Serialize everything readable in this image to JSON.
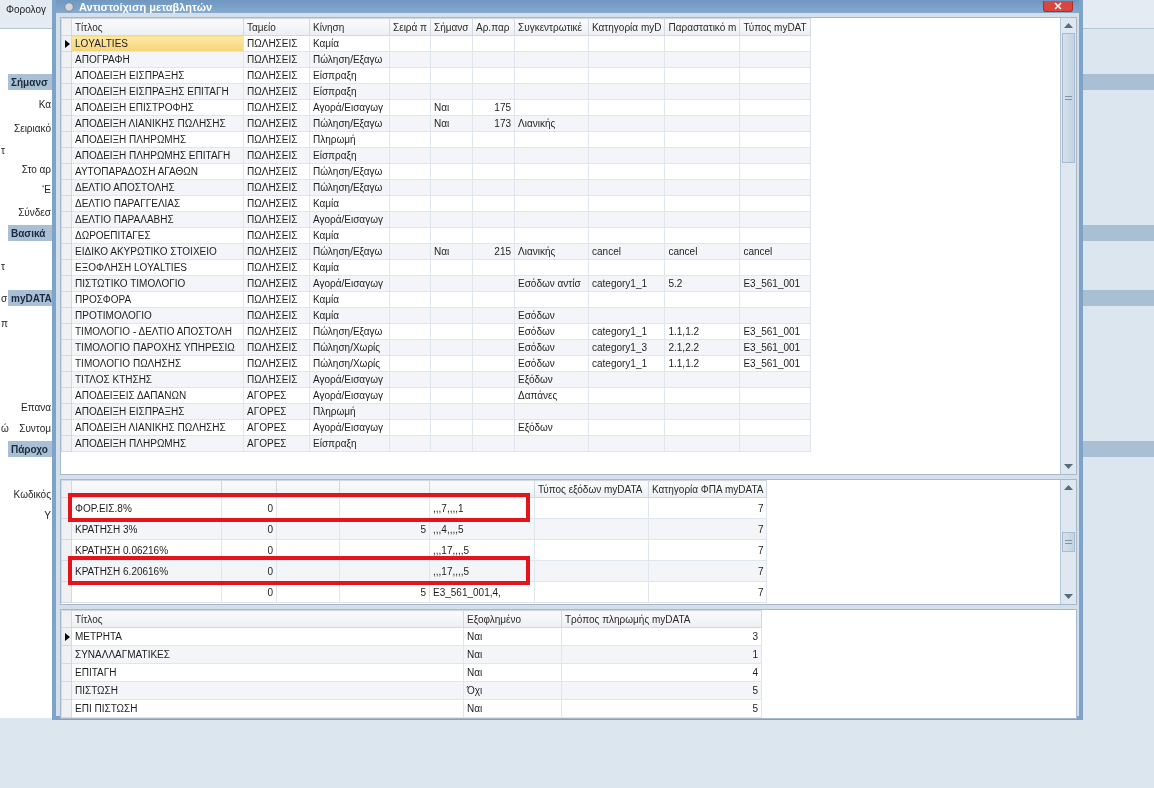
{
  "background": {
    "title": "Φορολογ",
    "side": [
      {
        "kind": "header",
        "text": "Σήμανσ"
      },
      {
        "kind": "label",
        "text": "Κα"
      },
      {
        "kind": "label",
        "text": "Σειριακό"
      },
      {
        "kind": "stub",
        "text": "τ"
      },
      {
        "kind": "label",
        "text": "Στο αρ"
      },
      {
        "kind": "label",
        "text": "‘Ε"
      },
      {
        "kind": "label",
        "text": "Σύνδεσ"
      },
      {
        "kind": "header",
        "text": "Βασικά"
      },
      {
        "kind": "stub",
        "text": "τ"
      },
      {
        "kind": "header",
        "text": "myDATA",
        "stub": "σ"
      },
      {
        "kind": "stub",
        "text": "π"
      },
      {
        "kind": "label",
        "text": "Επανα"
      },
      {
        "kind": "label",
        "text": "Συντομ",
        "stub": "ώ"
      },
      {
        "kind": "header",
        "text": "Πάροχο"
      },
      {
        "kind": "label",
        "text": "Κωδικός"
      },
      {
        "kind": "label",
        "text": "Υ"
      }
    ]
  },
  "dialog": {
    "title": "Αντιστοίχιση μεταβλητών",
    "top": {
      "columns": [
        "Τίτλος",
        "Ταμείο",
        "Κίνηση",
        "Σειρά π",
        "Σήμανσ",
        "Αρ.παρ",
        "Συγκεντρωτικέ",
        "Κατηγορία myD",
        "Παραστατικό m",
        "Τύπος myDAT"
      ],
      "rows": [
        {
          "selected": true,
          "cells": [
            "LOYALTIES",
            "ΠΩΛΗΣΕΙΣ",
            "Καμία",
            null,
            null,
            null,
            null,
            null,
            null,
            null
          ]
        },
        {
          "selected": false,
          "cells": [
            "ΑΠΟΓΡΑΦΗ",
            "ΠΩΛΗΣΕΙΣ",
            "Πώληση/Εξαγω",
            null,
            null,
            null,
            null,
            null,
            null,
            null
          ]
        },
        {
          "selected": false,
          "cells": [
            "ΑΠΟΔΕΙΞΗ ΕΙΣΠΡΑΞΗΣ",
            "ΠΩΛΗΣΕΙΣ",
            "Είσπραξη",
            null,
            null,
            null,
            null,
            null,
            null,
            null
          ]
        },
        {
          "selected": false,
          "cells": [
            "ΑΠΟΔΕΙΞΗ ΕΙΣΠΡΑΞΗΣ ΕΠΙΤΑΓΗ",
            "ΠΩΛΗΣΕΙΣ",
            "Είσπραξη",
            null,
            null,
            null,
            null,
            null,
            null,
            null
          ]
        },
        {
          "selected": false,
          "cells": [
            "ΑΠΟΔΕΙΞΗ ΕΠΙΣΤΡΟΦΗΣ",
            "ΠΩΛΗΣΕΙΣ",
            "Αγορά/Εισαγωγ",
            null,
            "Ναι",
            "175",
            null,
            null,
            null,
            null
          ]
        },
        {
          "selected": false,
          "cells": [
            "ΑΠΟΔΕΙΞΗ ΛΙΑΝΙΚΗΣ ΠΩΛΗΣΗΣ",
            "ΠΩΛΗΣΕΙΣ",
            "Πώληση/Εξαγω",
            null,
            "Ναι",
            "173",
            "Λιανικής",
            null,
            null,
            null
          ]
        },
        {
          "selected": false,
          "cells": [
            "ΑΠΟΔΕΙΞΗ ΠΛΗΡΩΜΗΣ",
            "ΠΩΛΗΣΕΙΣ",
            "Πληρωμή",
            null,
            null,
            null,
            null,
            null,
            null,
            null
          ]
        },
        {
          "selected": false,
          "cells": [
            "ΑΠΟΔΕΙΞΗ ΠΛΗΡΩΜΗΣ ΕΠΙΤΑΓΗ",
            "ΠΩΛΗΣΕΙΣ",
            "Είσπραξη",
            null,
            null,
            null,
            null,
            null,
            null,
            null
          ]
        },
        {
          "selected": false,
          "cells": [
            "ΑΥΤΟΠΑΡΑΔΟΣΗ ΑΓΑΘΩΝ",
            "ΠΩΛΗΣΕΙΣ",
            "Πώληση/Εξαγω",
            null,
            null,
            null,
            null,
            null,
            null,
            null
          ]
        },
        {
          "selected": false,
          "cells": [
            "ΔΕΛΤΙΟ ΑΠΟΣΤΟΛΗΣ",
            "ΠΩΛΗΣΕΙΣ",
            "Πώληση/Εξαγω",
            null,
            null,
            null,
            null,
            null,
            null,
            null
          ]
        },
        {
          "selected": false,
          "cells": [
            "ΔΕΛΤΙΟ ΠΑΡΑΓΓΕΛΙΑΣ",
            "ΠΩΛΗΣΕΙΣ",
            "Καμία",
            null,
            null,
            null,
            null,
            null,
            null,
            null
          ]
        },
        {
          "selected": false,
          "cells": [
            "ΔΕΛΤΙΟ ΠΑΡΑΛΑΒΗΣ",
            "ΠΩΛΗΣΕΙΣ",
            "Αγορά/Εισαγωγ",
            null,
            null,
            null,
            null,
            null,
            null,
            null
          ]
        },
        {
          "selected": false,
          "cells": [
            "ΔΩΡΟΕΠΙΤΑΓΕΣ",
            "ΠΩΛΗΣΕΙΣ",
            "Καμία",
            null,
            null,
            null,
            null,
            null,
            null,
            null
          ]
        },
        {
          "selected": false,
          "cells": [
            "ΕΙΔΙΚΟ ΑΚΥΡΩΤΙΚΟ ΣΤΟΙΧΕΙΟ",
            "ΠΩΛΗΣΕΙΣ",
            "Πώληση/Εξαγω",
            null,
            "Ναι",
            "215",
            "Λιανικής",
            "cancel",
            "cancel",
            "cancel"
          ]
        },
        {
          "selected": false,
          "cells": [
            "ΕΞΟΦΛΗΣΗ LOYALTIES",
            "ΠΩΛΗΣΕΙΣ",
            "Καμία",
            null,
            null,
            null,
            null,
            null,
            null,
            null
          ]
        },
        {
          "selected": false,
          "cells": [
            "ΠΙΣΤΩΤΙΚΟ ΤΙΜΟΛΟΓΙΟ",
            "ΠΩΛΗΣΕΙΣ",
            "Αγορά/Εισαγωγ",
            null,
            null,
            null,
            "Εσόδων αντίσ",
            "category1_1",
            "5.2",
            "E3_561_001"
          ]
        },
        {
          "selected": false,
          "cells": [
            "ΠΡΟΣΦΟΡΑ",
            "ΠΩΛΗΣΕΙΣ",
            "Καμία",
            null,
            null,
            null,
            null,
            null,
            null,
            null
          ]
        },
        {
          "selected": false,
          "cells": [
            "ΠΡΟΤΙΜΟΛΟΓΙΟ",
            "ΠΩΛΗΣΕΙΣ",
            "Καμία",
            null,
            null,
            null,
            "Εσόδων",
            null,
            null,
            null
          ]
        },
        {
          "selected": false,
          "cells": [
            "ΤΙΜΟΛΟΓΙΟ - ΔΕΛΤΙΟ ΑΠΟΣΤΟΛΗ",
            "ΠΩΛΗΣΕΙΣ",
            "Πώληση/Εξαγω",
            null,
            null,
            null,
            "Εσόδων",
            "category1_1",
            "1.1,1.2",
            "E3_561_001"
          ]
        },
        {
          "selected": false,
          "cells": [
            "ΤΙΜΟΛΟΓΙΟ ΠΑΡΟΧΗΣ ΥΠΗΡΕΣΙΩ",
            "ΠΩΛΗΣΕΙΣ",
            "Πώληση/Χωρίς",
            null,
            null,
            null,
            "Εσόδων",
            "category1_3",
            "2.1,2.2",
            "E3_561_001"
          ]
        },
        {
          "selected": false,
          "cells": [
            "ΤΙΜΟΛΟΓΙΟ ΠΩΛΗΣΗΣ",
            "ΠΩΛΗΣΕΙΣ",
            "Πώληση/Χωρίς",
            null,
            null,
            null,
            "Εσόδων",
            "category1_1",
            "1.1,1.2",
            "E3_561_001"
          ]
        },
        {
          "selected": false,
          "cells": [
            "ΤΙΤΛΟΣ ΚΤΗΣΗΣ",
            "ΠΩΛΗΣΕΙΣ",
            "Αγορά/Εισαγωγ",
            null,
            null,
            null,
            "Εξόδων",
            null,
            null,
            null
          ]
        },
        {
          "selected": false,
          "cells": [
            "ΑΠΟΔΕΙΞΕΙΣ ΔΑΠΑΝΩΝ",
            "ΑΓΟΡΕΣ",
            "Αγορά/Εισαγωγ",
            null,
            null,
            null,
            "Δαπάνες",
            null,
            null,
            null
          ]
        },
        {
          "selected": false,
          "cells": [
            "ΑΠΟΔΕΙΞΗ ΕΙΣΠΡΑΞΗΣ",
            "ΑΓΟΡΕΣ",
            "Πληρωμή",
            null,
            null,
            null,
            null,
            null,
            null,
            null
          ]
        },
        {
          "selected": false,
          "cells": [
            "ΑΠΟΔΕΙΞΗ ΛΙΑΝΙΚΗΣ ΠΩΛΗΣΗΣ",
            "ΑΓΟΡΕΣ",
            "Αγορά/Εισαγωγ",
            null,
            null,
            null,
            "Εξόδων",
            null,
            null,
            null
          ]
        },
        {
          "selected": false,
          "cells": [
            "ΑΠΟΔΕΙΞΗ ΠΛΗΡΩΜΗΣ",
            "ΑΓΟΡΕΣ",
            "Είσπραξη",
            null,
            null,
            null,
            null,
            null,
            null,
            null
          ]
        }
      ]
    },
    "middle": {
      "columns": [
        null,
        null,
        null,
        null,
        null,
        "Τύπος εξόδων myDATA",
        "Κατηγορία ΦΠΑ myDATA"
      ],
      "rows": [
        {
          "highlighted": true,
          "cells": [
            "ΦΟΡ.ΕΙΣ.8%",
            "0",
            null,
            null,
            ",,,7,,,,1",
            null,
            "7"
          ]
        },
        {
          "highlighted": false,
          "cells": [
            "ΚΡΑΤΗΣΗ 3%",
            "0",
            null,
            "5",
            ",,,4,,,,5",
            null,
            "7"
          ]
        },
        {
          "highlighted": false,
          "cells": [
            "ΚΡΑΤΗΣΗ 0.06216%",
            "0",
            null,
            null,
            ",,,17,,,,5",
            null,
            "7"
          ]
        },
        {
          "highlighted": true,
          "cells": [
            "ΚΡΑΤΗΣΗ 6.20616%",
            "0",
            null,
            null,
            ",,,17,,,,5",
            null,
            "7"
          ]
        },
        {
          "highlighted": false,
          "cells": [
            null,
            "0",
            null,
            "5",
            "E3_561_001,4,",
            null,
            "7"
          ]
        }
      ]
    },
    "bottom": {
      "columns": [
        "Τίτλος",
        "Εξοφλημένο",
        "Τρόπος πληρωμής myDATA"
      ],
      "rows": [
        {
          "selected": true,
          "cells": [
            "ΜΕΤΡΗΤΑ",
            "Ναι",
            "3"
          ]
        },
        {
          "selected": false,
          "cells": [
            "ΣΥΝΑΛΛΑΓΜΑΤΙΚΕΣ",
            "Ναι",
            "1"
          ]
        },
        {
          "selected": false,
          "cells": [
            "ΕΠΙΤΑΓΗ",
            "Ναι",
            "4"
          ]
        },
        {
          "selected": false,
          "cells": [
            "ΠΙΣΤΩΣΗ",
            "Όχι",
            "5"
          ]
        },
        {
          "selected": false,
          "cells": [
            "ΕΠΙ ΠΙΣΤΩΣΗ",
            "Ναι",
            "5"
          ]
        }
      ]
    }
  }
}
